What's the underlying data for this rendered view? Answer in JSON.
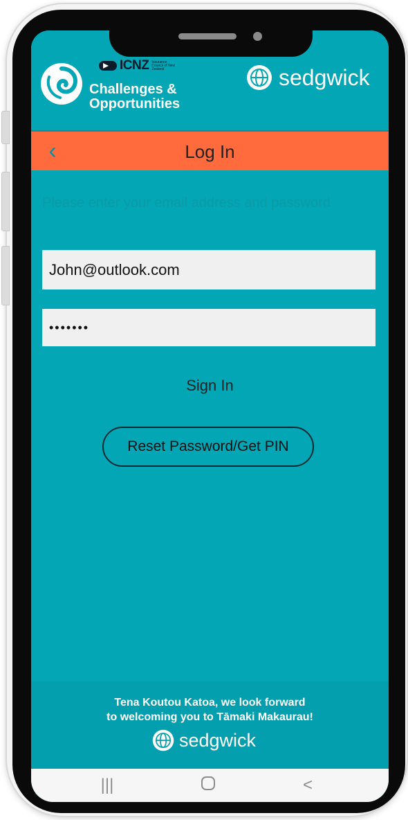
{
  "header": {
    "org_logo_text": "ICNZ",
    "org_logo_subtext": "Insurance Council of New Zealand",
    "event_title_line1": "Challenges &",
    "event_title_line2": "Opportunities",
    "brand_name": "sedgwick"
  },
  "titlebar": {
    "title": "Log In",
    "back_icon": "chevron-left-icon"
  },
  "form": {
    "instructions": "Please enter your email address and password",
    "email_value": "John@outlook.com",
    "password_value": "•••••••",
    "sign_in_label": "Sign In",
    "reset_label": "Reset Password/Get PIN"
  },
  "footer": {
    "message_line1": "Tena Koutou Katoa, we look forward",
    "message_line2": "to welcoming you to Tāmaki Makaurau!",
    "brand_name": "sedgwick"
  },
  "navbar": {
    "recents_icon": "|||",
    "home_icon": "home-icon",
    "back_icon": "<"
  },
  "colors": {
    "primary": "#03a6b5",
    "accent": "#ff6b3d",
    "field_bg": "#f0f0f0"
  }
}
